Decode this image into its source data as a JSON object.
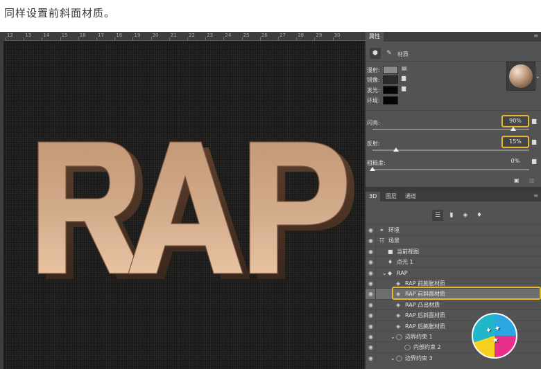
{
  "caption": "同样设置前斜面材质。",
  "ruler": {
    "ticks": [
      "12",
      "13",
      "14",
      "15",
      "16",
      "17",
      "18",
      "19",
      "20",
      "21",
      "22",
      "23",
      "24",
      "25",
      "26",
      "27",
      "28",
      "29",
      "30"
    ]
  },
  "canvas": {
    "text": "RAP",
    "text_color": "#c9a07e"
  },
  "properties": {
    "tab": "属性",
    "section": "材质",
    "rows": {
      "diffuse": "漫射:",
      "specular": "镜像:",
      "glow": "发光:",
      "ambient": "环境:"
    },
    "sliders": {
      "shine": {
        "label": "闪亮:",
        "value": "90%",
        "level": 0.9
      },
      "reflection": {
        "label": "反射:",
        "value": "15%",
        "level": 0.15
      },
      "roughness": {
        "label": "粗糙度:",
        "value": "0%",
        "level": 0.0
      }
    },
    "colors": {
      "diffuse": "#8a8a8a",
      "specular": "#2a2a2a",
      "glow": "#050505",
      "ambient": "#050505",
      "highlight": "#e6b82e"
    }
  },
  "panel3d": {
    "tabs": [
      "3D",
      "图层",
      "通道"
    ],
    "items": [
      {
        "label": "环境",
        "icon": "environment-icon",
        "indent": 0
      },
      {
        "label": "场景",
        "icon": "scene-icon",
        "indent": 0
      },
      {
        "label": "当前视图",
        "icon": "camera-icon",
        "indent": 1
      },
      {
        "label": "点光 1",
        "icon": "light-bulb-icon",
        "indent": 1
      },
      {
        "label": "RAP",
        "icon": "mesh-icon",
        "indent": 1
      },
      {
        "label": "RAP 前膨胀材质",
        "icon": "material-icon",
        "indent": 2
      },
      {
        "label": "RAP 前斜面材质",
        "icon": "material-icon",
        "indent": 2,
        "selected": true
      },
      {
        "label": "RAP 凸出材质",
        "icon": "material-icon",
        "indent": 2
      },
      {
        "label": "RAP 后斜面材质",
        "icon": "material-icon",
        "indent": 2
      },
      {
        "label": "RAP 后膨胀材质",
        "icon": "material-icon",
        "indent": 2
      },
      {
        "label": "边界约束 1",
        "icon": "constraint-icon",
        "indent": 2
      },
      {
        "label": "内部约束 2",
        "icon": "constraint-icon",
        "indent": 3
      },
      {
        "label": "边界约束 3",
        "icon": "constraint-icon",
        "indent": 2
      }
    ]
  }
}
